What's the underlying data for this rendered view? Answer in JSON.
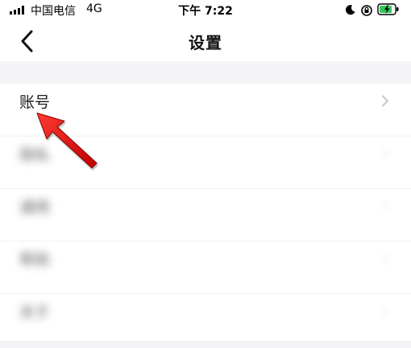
{
  "status_bar": {
    "carrier": "中国电信",
    "network": "4G",
    "time": "下午 7:22"
  },
  "nav": {
    "title": "设置"
  },
  "settings": {
    "items": [
      {
        "label": "账号"
      },
      {
        "label": "隐私"
      },
      {
        "label": "通用"
      },
      {
        "label": "帮助"
      },
      {
        "label": "关于"
      }
    ]
  },
  "colors": {
    "annotation_arrow": "#e01010",
    "section_gap": "#f4f4f6",
    "battery_charging": "#34c759"
  },
  "icons": {
    "back": "chevron-left-icon",
    "row": "chevron-right-icon",
    "moon": "moon-icon",
    "rotation_lock": "lock-rotation-icon",
    "battery": "battery-charging-icon"
  }
}
